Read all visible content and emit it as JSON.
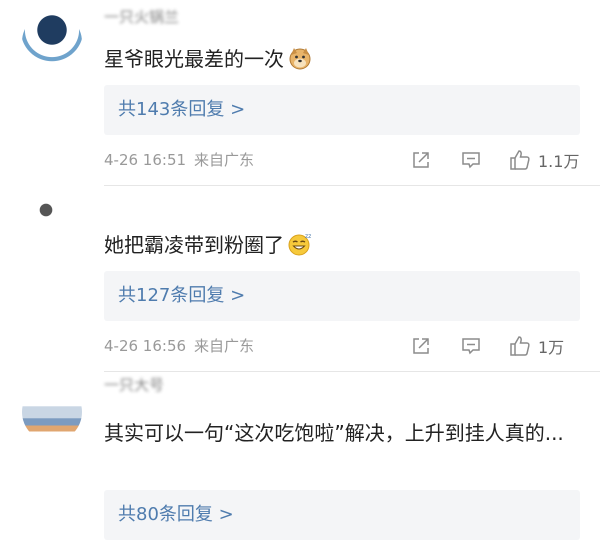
{
  "comments": [
    {
      "username": "一只火锅兰",
      "text": "星爷眼光最差的一次",
      "emoji": "doge-emoji",
      "replies_label": "共143条回复 >",
      "time": "4-26 16:51",
      "source": "来自广东",
      "likes": "1.1万"
    },
    {
      "username": "",
      "text": "她把霸凌带到粉圈了",
      "emoji": "sleepy-grin-emoji",
      "replies_label": "共127条回复 >",
      "time": "4-26 16:56",
      "source": "来自广东",
      "likes": "1万"
    },
    {
      "username": "一只大号",
      "text": "其实可以一句“这次吃饱啦”解决，上升到挂人真的...",
      "replies_label": "共80条回复 >"
    }
  ],
  "icons": {
    "share": "share-icon",
    "comment": "comment-icon",
    "like": "thumbs-up-icon"
  },
  "colors": {
    "link": "#4f7cae",
    "meta": "#999999",
    "reply_bg": "#f4f5f7"
  }
}
